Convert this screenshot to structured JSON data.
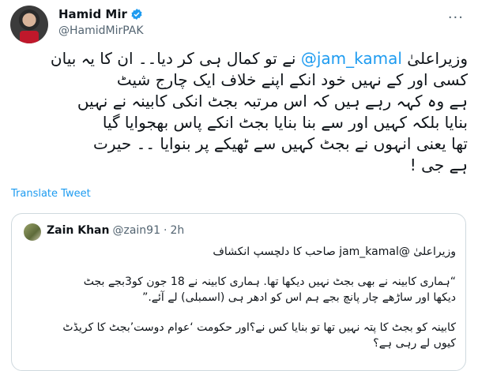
{
  "author": {
    "name": "Hamid Mir",
    "handle": "@HamidMirPAK"
  },
  "tweet": {
    "lines": [
      {
        "before": "وزیراعلیٰ ",
        "mention": "@jam_kamal",
        "after": " نے تو کمال ہی کر دیا۔۔ ان کا یہ بیان"
      },
      {
        "text": "کسی اور کے نہیں خود انکے اپنے خلاف ایک چارج شیٹ"
      },
      {
        "text": "ہے وہ کہہ رہے ہیں کہ اس مرتبہ بجٹ انکی کابینہ نے نہیں"
      },
      {
        "text": "بنایا بلکہ کہیں اور سے بنا بنایا بجٹ انکے پاس بھجوایا گیا"
      },
      {
        "text": "تھا یعنی انہوں نے بجٹ کہیں سے ٹھیکے پر بنوایا ۔۔ حیرت"
      },
      {
        "text": "ہے جی !"
      }
    ],
    "translate_label": "Translate Tweet"
  },
  "quoted": {
    "name": "Zain Khan",
    "handle": "@zain91",
    "separator": "·",
    "time": "2h",
    "paragraphs": [
      [
        "وزیراعلیٰ @jam_kamal صاحب کا دلچسپ انکشاف"
      ],
      [
        "“ہماری کابینہ نے بھی بجٹ نہیں دیکھا تھا. ہماری کابینہ نے 18 جون کو3بجے بجٹ",
        "دیکھا اور ساڑھے چار پانچ بجے ہم اس کو ادھر ہی (اسمبلی) لے آئے.”"
      ],
      [
        "کابینہ کو بجٹ کا پتہ نہیں تھا تو بنایا کس نے؟اور حکومت ‘عوام دوست’بجٹ کا کریڈٹ",
        "کیوں لے رہی ہے؟"
      ]
    ]
  },
  "colors": {
    "accent": "#1d9bf0",
    "secondary_text": "#536471",
    "border": "#cfd9de"
  }
}
